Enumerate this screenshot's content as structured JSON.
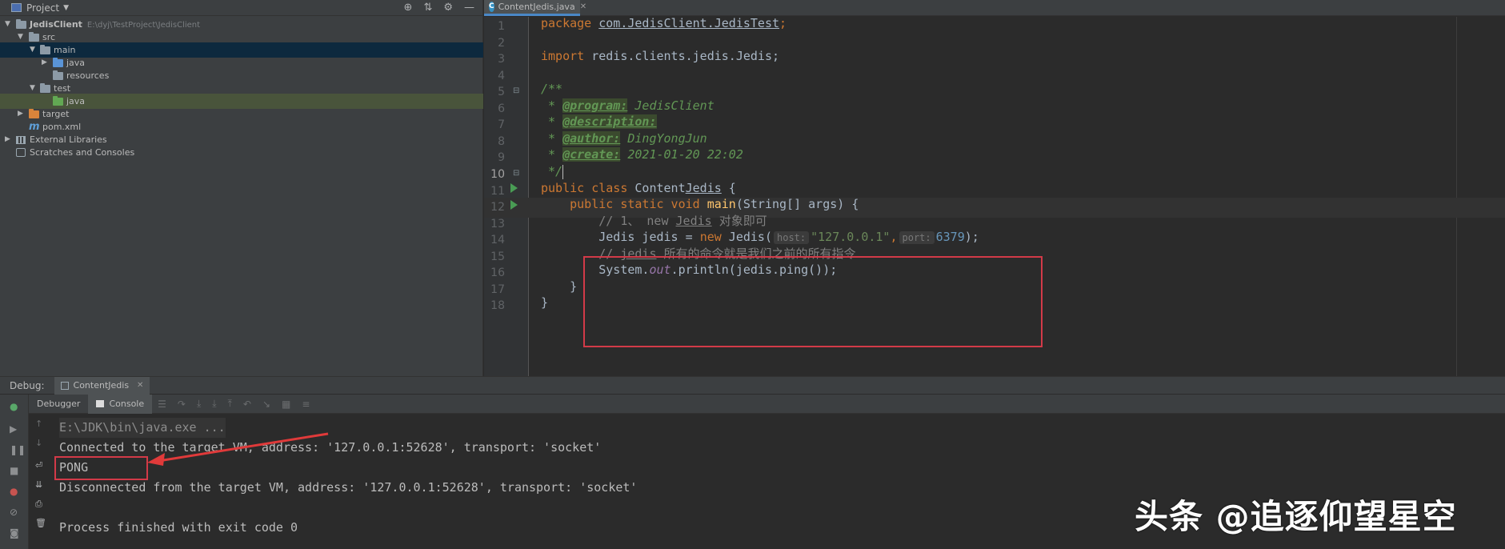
{
  "project_panel": {
    "title": "Project",
    "tree": [
      {
        "label": "JedisClient",
        "path": "E:\\dyj\\TestProject\\JedisClient"
      },
      {
        "label": "src"
      },
      {
        "label": "main"
      },
      {
        "label": "java"
      },
      {
        "label": "resources"
      },
      {
        "label": "test"
      },
      {
        "label": "java"
      },
      {
        "label": "target"
      },
      {
        "label": "pom.xml"
      },
      {
        "label": "External Libraries"
      },
      {
        "label": "Scratches and Consoles"
      }
    ]
  },
  "editor": {
    "tab_label": "ContentJedis.java",
    "line_numbers": [
      "1",
      "2",
      "3",
      "4",
      "5",
      "6",
      "7",
      "8",
      "9",
      "10",
      "11",
      "12",
      "13",
      "14",
      "15",
      "16",
      "17",
      "18"
    ],
    "current_line": "10",
    "code": {
      "l1_kw": "package",
      "l1_pkg": "com.JedisClient.JedisTest",
      "l1_end": ";",
      "l3_kw": "import",
      "l3_rest": " redis.clients.jedis.Jedis;",
      "l5": "/**",
      "l6_star": " * ",
      "l6_tag": "@program:",
      "l6_val": " JedisClient",
      "l7_star": " * ",
      "l7_tag": "@description:",
      "l8_star": " * ",
      "l8_tag": "@author:",
      "l8_val": " DingYongJun",
      "l9_star": " * ",
      "l9_tag": "@create:",
      "l9_val": " 2021-01-20 22:02",
      "l10": " */",
      "l11_kw": "public class",
      "l11_name_a": " Content",
      "l11_name_b": "Jedis",
      "l11_end": " {",
      "l12_kw": "    public static void",
      "l12_fn": " main",
      "l12_rest": "(String[] args) {",
      "l13_a": "        // 1、 new ",
      "l13_b": "Jedis",
      "l13_c": " 对象即可",
      "l14_a": "        Jedis jedis = ",
      "l14_kw": "new",
      "l14_b": " Jedis(",
      "l14_hint1": "host:",
      "l14_str": "\"127.0.0.1\"",
      "l14_comma": ",",
      "l14_hint2": "port:",
      "l14_num": "6379",
      "l14_end": ");",
      "l15_a": "        // ",
      "l15_b": "jedis",
      "l15_c": " 所有的命令就是我们之前的所有指令",
      "l16_a": "        System.",
      "l16_field": "out",
      "l16_b": ".println(jedis.ping());",
      "l17": "    }",
      "l18": "}"
    }
  },
  "debug": {
    "label": "Debug:",
    "tab_label": "ContentJedis",
    "subtabs": [
      "Debugger",
      "Console"
    ],
    "console_lines": [
      "E:\\JDK\\bin\\java.exe ...",
      "Connected to the target VM, address: '127.0.0.1:52628', transport: 'socket'",
      "PONG",
      "Disconnected from the target VM, address: '127.0.0.1:52628', transport: 'socket'",
      "",
      "Process finished with exit code 0"
    ]
  },
  "watermark": "头条 @追逐仰望星空",
  "colors": {
    "background": "#2b2b2b",
    "panel": "#3c3f41",
    "keyword": "#cc7832",
    "string": "#6a8759",
    "number": "#6897bb",
    "doc": "#629755",
    "annotation_box": "#d23a48",
    "run_marker": "#499c54"
  }
}
